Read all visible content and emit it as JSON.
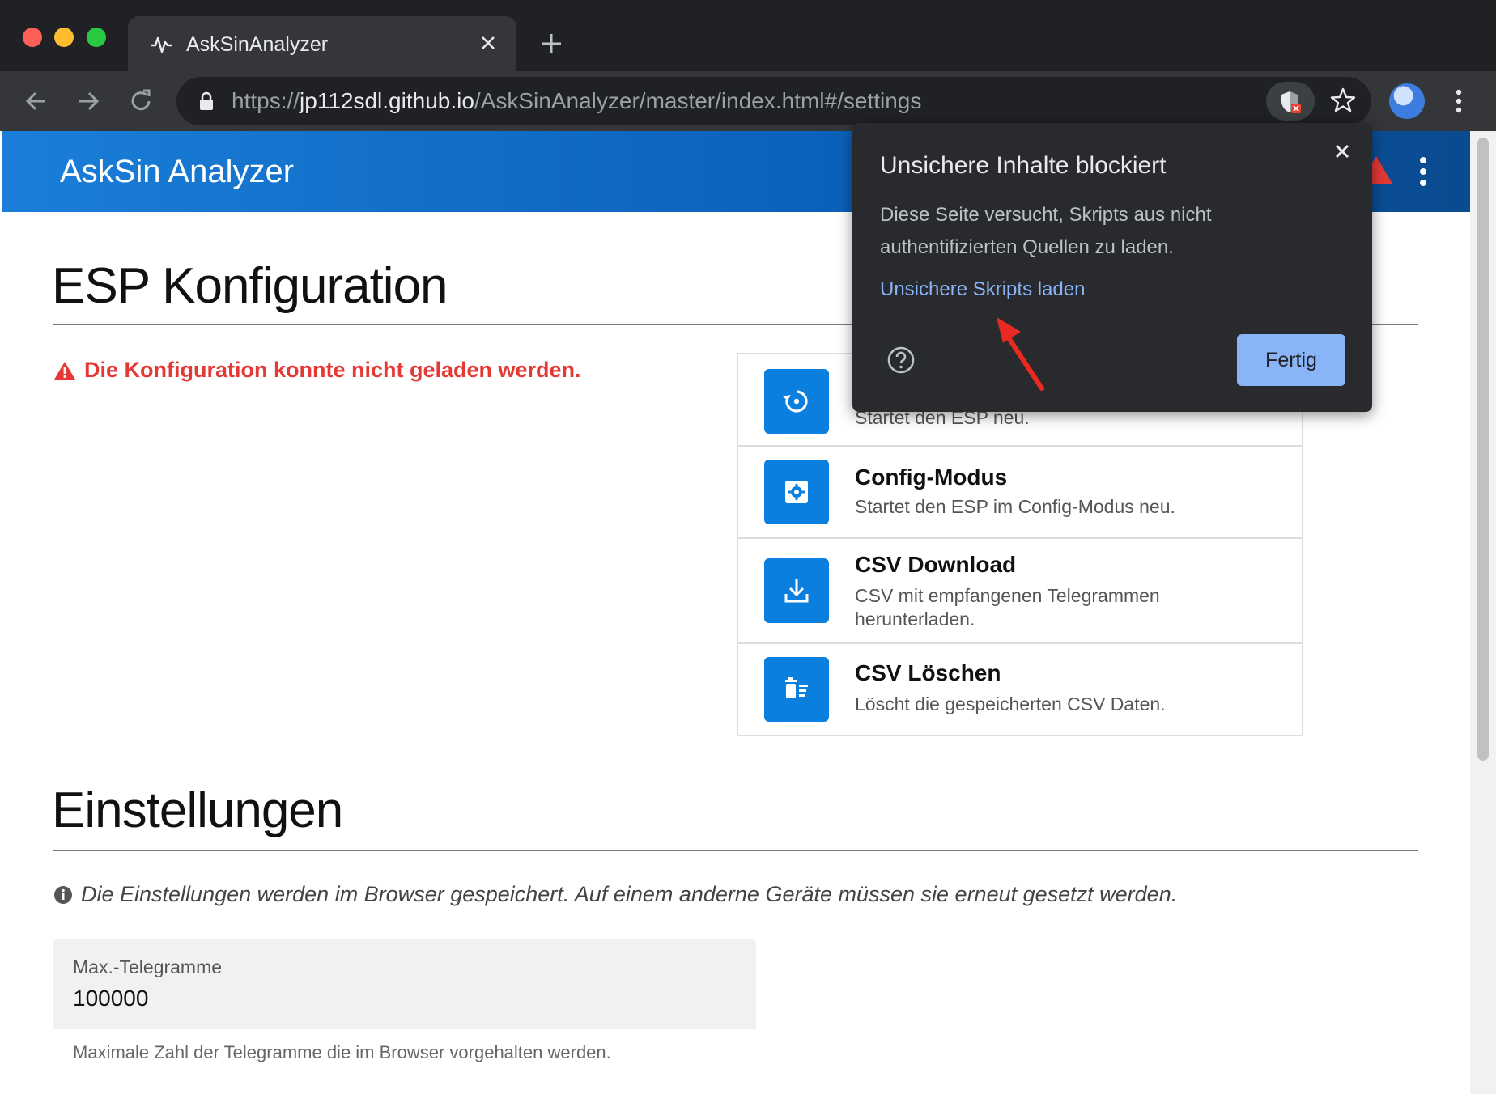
{
  "browser": {
    "tab_title": "AskSinAnalyzer",
    "url": {
      "scheme": "https://",
      "host": "jp112sdl.github.io",
      "path": "/AskSinAnalyzer/master/index.html#/settings"
    }
  },
  "app": {
    "title": "AskSin Analyzer"
  },
  "esp": {
    "heading": "ESP Konfiguration",
    "error": "Die Konfiguration konnte nicht geladen werden.",
    "actions": [
      {
        "title": "",
        "desc": "Startet den ESP neu.",
        "icon": "restart-icon"
      },
      {
        "title": "Config-Modus",
        "desc": "Startet den ESP im Config-Modus neu.",
        "icon": "settings-icon"
      },
      {
        "title": "CSV Download",
        "desc": "CSV mit empfangenen Telegrammen herunterladen.",
        "icon": "download-icon"
      },
      {
        "title": "CSV Löschen",
        "desc": "Löscht die gespeicherten CSV Daten.",
        "icon": "delete-icon"
      }
    ]
  },
  "settings": {
    "heading": "Einstellungen",
    "info": "Die Einstellungen werden im Browser gespeichert. Auf einem anderne Geräte müssen sie erneut gesetzt werden.",
    "max_telegrams": {
      "label": "Max.-Telegramme",
      "value": "100000",
      "help": "Maximale Zahl der Telegramme die im Browser vorgehalten werden."
    }
  },
  "popup": {
    "title": "Unsichere Inhalte blockiert",
    "body": "Diese Seite versucht, Skripts aus nicht authentifizierten Quellen zu laden.",
    "link": "Unsichere Skripts laden",
    "done_button": "Fertig"
  },
  "colors": {
    "appbar": "#0a6fcb",
    "action_icon_bg": "#0a7fde",
    "error": "#e53935",
    "popup_bg": "#292a2d",
    "popup_link": "#8ab4f8"
  }
}
